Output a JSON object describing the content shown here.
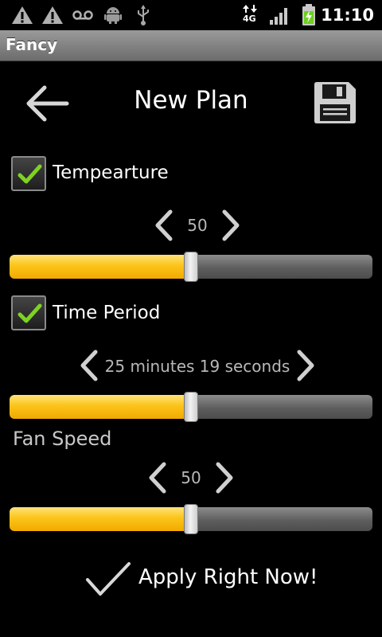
{
  "status_bar": {
    "time": "11:10",
    "network_label": "4G",
    "icons": [
      "warning-icon",
      "warning-icon",
      "voicemail-icon",
      "android-debug-icon",
      "usb-icon",
      "network-4g-icon",
      "signal-icon",
      "battery-charging-icon"
    ]
  },
  "app": {
    "title": "Fancy"
  },
  "header": {
    "title": "New Plan",
    "back_icon": "arrow-left-icon",
    "save_icon": "floppy-disk-icon"
  },
  "temperature": {
    "label": "Tempearture",
    "checked": true,
    "value": "50",
    "slider_fraction": 0.5
  },
  "time_period": {
    "label": "Time Period",
    "checked": true,
    "value": "25 minutes 19 seconds",
    "slider_fraction": 0.5
  },
  "fan_speed": {
    "label": "Fan Speed",
    "value": "50",
    "slider_fraction": 0.5
  },
  "apply": {
    "label": "Apply Right Now!",
    "icon": "checkmark-icon"
  },
  "colors": {
    "slider_fill": "#fcc419",
    "slider_track": "#5e5e5e",
    "check_green": "#7ed321",
    "title_bar": "#7d7d7d"
  }
}
